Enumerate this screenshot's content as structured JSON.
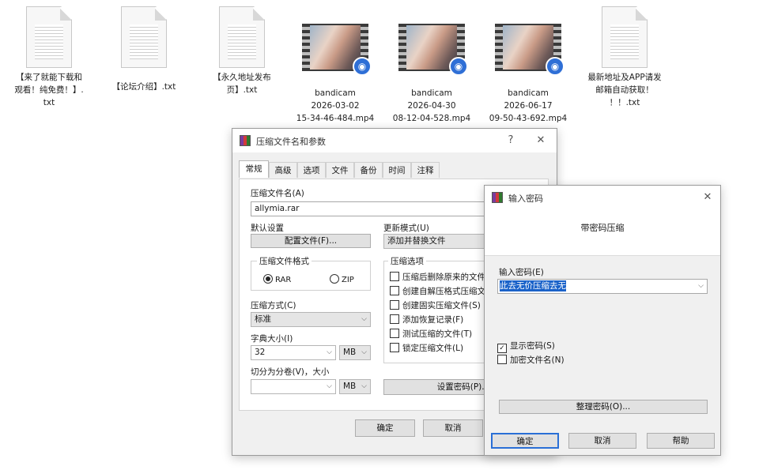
{
  "desktop": {
    "files": [
      {
        "type": "text",
        "label": "【来了就能下载和\n观看！纯免费！】.\ntxt"
      },
      {
        "type": "text",
        "label": "【论坛介绍】.txt"
      },
      {
        "type": "text",
        "label": "【永久地址发布\n页】.txt"
      },
      {
        "type": "video",
        "label": "bandicam\n2026-03-02\n15-34-46-484.mp4"
      },
      {
        "type": "video",
        "label": "bandicam\n2026-04-30\n08-12-04-528.mp4"
      },
      {
        "type": "video",
        "label": "bandicam\n2026-06-17\n09-50-43-692.mp4"
      },
      {
        "type": "text",
        "label": "最新地址及APP请发\n邮箱自动获取！\n！！.txt"
      }
    ]
  },
  "archive_dialog": {
    "title": "压缩文件名和参数",
    "help_btn": "?",
    "close_btn": "✕",
    "tabs": [
      "常规",
      "高级",
      "选项",
      "文件",
      "备份",
      "时间",
      "注释"
    ],
    "active_tab": "常规",
    "archive_name_label": "压缩文件名(A)",
    "archive_name_value": "allymia.rar",
    "default_settings_label": "默认设置",
    "profiles_button": "配置文件(F)...",
    "update_mode_label": "更新模式(U)",
    "update_mode_value": "添加并替换文件",
    "format_group_label": "压缩文件格式",
    "format_rar": "RAR",
    "format_zip": "ZIP",
    "format_selected": "RAR",
    "method_label": "压缩方式(C)",
    "method_value": "标准",
    "dict_label": "字典大小(I)",
    "dict_value": "32",
    "dict_unit": "MB",
    "split_label": "切分为分卷(V)，大小",
    "split_value": "",
    "split_unit": "MB",
    "options_group_label": "压缩选项",
    "options": [
      {
        "label": "压缩后删除原来的文件",
        "checked": false
      },
      {
        "label": "创建自解压格式压缩文",
        "checked": false
      },
      {
        "label": "创建固实压缩文件(S)",
        "checked": false
      },
      {
        "label": "添加恢复记录(F)",
        "checked": false
      },
      {
        "label": "测试压缩的文件(T)",
        "checked": false
      },
      {
        "label": "锁定压缩文件(L)",
        "checked": false
      }
    ],
    "set_password_button": "设置密码(P)...",
    "ok_button": "确定",
    "cancel_button": "取消"
  },
  "password_dialog": {
    "title": "输入密码",
    "close_btn": "✕",
    "header": "带密码压缩",
    "enter_password_label": "输入密码(E)",
    "password_value": "此去无价压缩去无",
    "show_password_label": "显示密码(S)",
    "show_password_checked": true,
    "encrypt_names_label": "加密文件名(N)",
    "encrypt_names_checked": false,
    "organize_button": "整理密码(O)...",
    "ok_button": "确定",
    "cancel_button": "取消",
    "help_button": "帮助"
  },
  "colors": {
    "selection": "#1a62c9",
    "window_bg": "#f0f0f0",
    "default_button_border": "#2a6fd6"
  }
}
